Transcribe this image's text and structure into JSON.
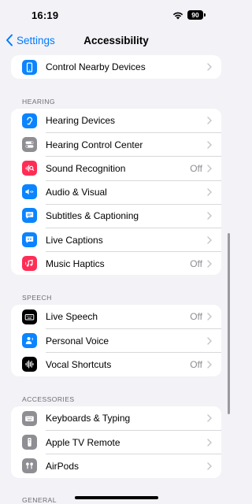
{
  "status_bar": {
    "time": "16:19",
    "battery": "90"
  },
  "nav": {
    "back_label": "Settings",
    "title": "Accessibility"
  },
  "top_group": {
    "items": [
      {
        "label": "Control Nearby Devices",
        "icon": "iphone-icon",
        "color": "#0a84ff"
      }
    ]
  },
  "hearing": {
    "header": "HEARING",
    "items": [
      {
        "label": "Hearing Devices",
        "icon": "ear-icon",
        "color": "#0a84ff"
      },
      {
        "label": "Hearing Control Center",
        "icon": "toggles-icon",
        "color": "#8e8e93"
      },
      {
        "label": "Sound Recognition",
        "value": "Off",
        "icon": "waveform-search-icon",
        "color": "#ff2d55"
      },
      {
        "label": "Audio & Visual",
        "icon": "speaker-eye-icon",
        "color": "#0a84ff"
      },
      {
        "label": "Subtitles & Captioning",
        "icon": "caption-bubble-icon",
        "color": "#0a84ff"
      },
      {
        "label": "Live Captions",
        "icon": "quote-bubble-icon",
        "color": "#0a84ff"
      },
      {
        "label": "Music Haptics",
        "value": "Off",
        "icon": "music-haptics-icon",
        "color": "#ff2d55"
      }
    ]
  },
  "speech": {
    "header": "SPEECH",
    "items": [
      {
        "label": "Live Speech",
        "value": "Off",
        "icon": "keyboard-icon",
        "color": "#000000"
      },
      {
        "label": "Personal Voice",
        "icon": "person-wave-icon",
        "color": "#0a84ff"
      },
      {
        "label": "Vocal Shortcuts",
        "value": "Off",
        "icon": "waveform-icon",
        "color": "#000000"
      }
    ]
  },
  "accessories": {
    "header": "ACCESSORIES",
    "items": [
      {
        "label": "Keyboards & Typing",
        "icon": "keyboard-icon",
        "color": "#8e8e93"
      },
      {
        "label": "Apple TV Remote",
        "icon": "remote-icon",
        "color": "#8e8e93"
      },
      {
        "label": "AirPods",
        "icon": "airpods-icon",
        "color": "#8e8e93"
      }
    ]
  },
  "general": {
    "header": "GENERAL"
  }
}
